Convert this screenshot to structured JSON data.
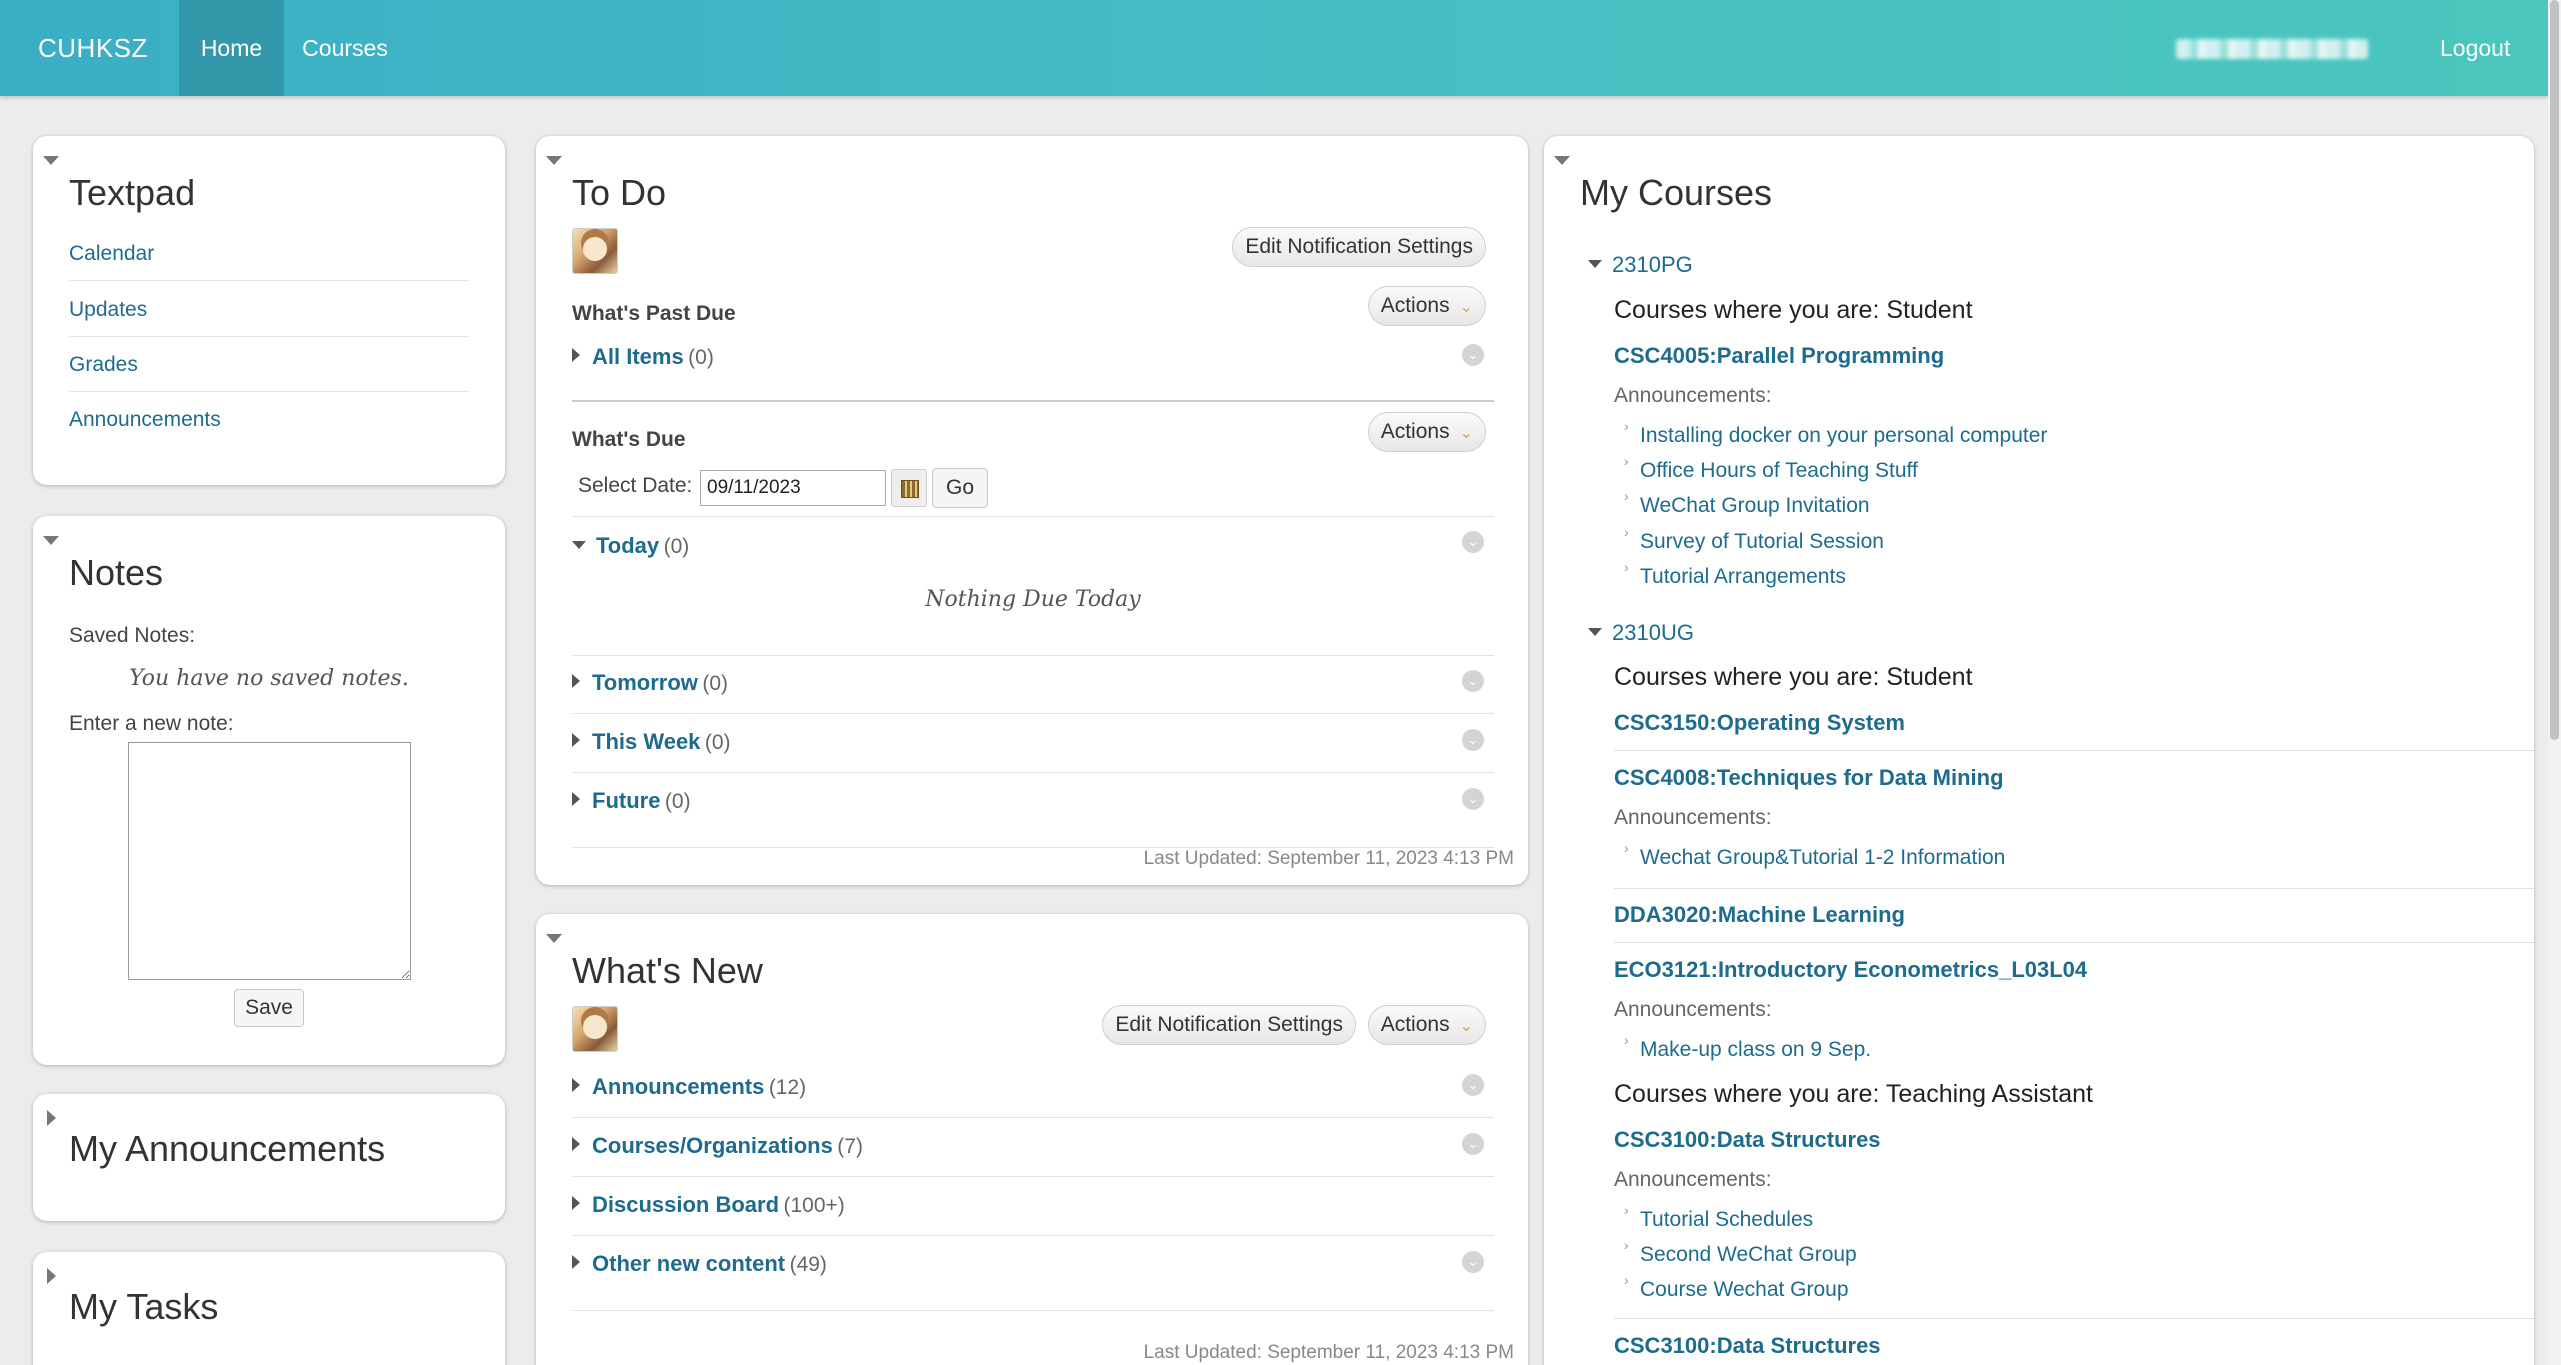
{
  "nav": {
    "brand": "CUHKSZ",
    "home": "Home",
    "courses": "Courses",
    "logout": "Logout"
  },
  "textpad": {
    "title": "Textpad",
    "links": [
      "Calendar",
      "Updates",
      "Grades",
      "Announcements"
    ]
  },
  "notes": {
    "title": "Notes",
    "saved_label": "Saved Notes:",
    "empty": "You have no saved notes.",
    "enter_label": "Enter a new note:",
    "textarea_value": "",
    "save": "Save"
  },
  "my_announcements": {
    "title": "My Announcements"
  },
  "my_tasks": {
    "title": "My Tasks"
  },
  "todo": {
    "title": "To Do",
    "edit_notifications": "Edit Notification Settings",
    "actions": "Actions",
    "past_due": {
      "heading": "What's Past Due",
      "all_items": "All Items",
      "all_items_count": "(0)"
    },
    "due": {
      "heading": "What's Due",
      "select_date_label": "Select Date:",
      "date_value": "09/11/2023",
      "go": "Go",
      "today": "Today",
      "today_count": "(0)",
      "nothing_due": "Nothing Due Today",
      "tomorrow": "Tomorrow",
      "tomorrow_count": "(0)",
      "this_week": "This Week",
      "this_week_count": "(0)",
      "future": "Future",
      "future_count": "(0)"
    },
    "last_updated": "Last Updated: September 11, 2023 4:13 PM"
  },
  "whats_new": {
    "title": "What's New",
    "edit_notifications": "Edit Notification Settings",
    "actions": "Actions",
    "items": [
      {
        "label": "Announcements",
        "count": "(12)"
      },
      {
        "label": "Courses/Organizations",
        "count": "(7)"
      },
      {
        "label": "Discussion Board",
        "count": "(100+)"
      },
      {
        "label": "Other new content",
        "count": "(49)"
      }
    ],
    "last_updated": "Last Updated: September 11, 2023 4:13 PM"
  },
  "my_courses": {
    "title": "My Courses",
    "terms": [
      {
        "name": "2310PG",
        "role": "Courses where you are: Student",
        "course": "CSC4005:Parallel Programming",
        "ann_label": "Announcements:",
        "announcements": [
          "Installing docker on your personal computer",
          "Office Hours of Teaching Stuff",
          "WeChat Group Invitation",
          "Survey of Tutorial Session",
          "Tutorial Arrangements"
        ]
      },
      {
        "name": "2310UG",
        "role_student": "Courses where you are: Student",
        "c1": "CSC3150:Operating System",
        "c2": "CSC4008:Techniques for Data Mining",
        "c2_ann_label": "Announcements:",
        "c2_ann": [
          "Wechat Group&Tutorial 1-2 Information"
        ],
        "c3": "DDA3020:Machine Learning",
        "c4": "ECO3121:Introductory Econometrics_L03L04",
        "c4_ann_label": "Announcements:",
        "c4_ann": [
          "Make-up class on 9 Sep."
        ],
        "role_ta": "Courses where you are: Teaching Assistant",
        "c5": "CSC3100:Data Structures",
        "c5_ann_label": "Announcements:",
        "c5_ann": [
          "Tutorial Schedules",
          "Second WeChat Group",
          "Course Wechat Group"
        ],
        "c6": "CSC3100:Data Structures"
      }
    ]
  },
  "icons": {
    "collapse": "triangle-down-icon",
    "expand": "triangle-right-icon",
    "calendar": "calendar-icon",
    "chevron": "chevron-down-circle-icon"
  },
  "colors": {
    "nav_start": "#3aaec5",
    "nav_end": "#4ac6bc",
    "link": "#1e6b8e"
  }
}
